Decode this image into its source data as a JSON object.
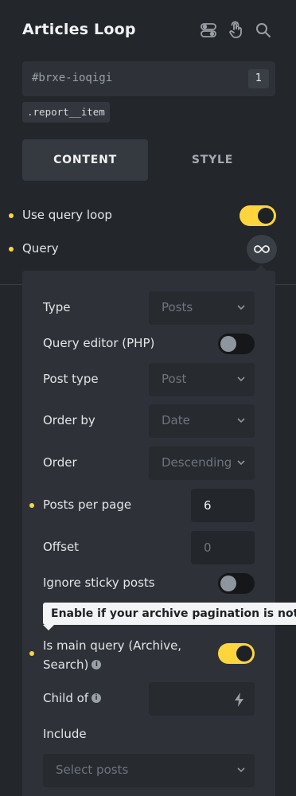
{
  "header": {
    "title": "Articles Loop",
    "icons": [
      "toggle-settings-icon",
      "pointer-hand-icon",
      "search-icon"
    ]
  },
  "element": {
    "id": "#brxe-ioqigi",
    "id_badge": "1",
    "class": ".report__item"
  },
  "tabs": [
    {
      "label": "CONTENT",
      "active": true
    },
    {
      "label": "STYLE",
      "active": false
    }
  ],
  "loop": {
    "use_query_loop_label": "Use query loop",
    "use_query_loop": true,
    "query_label": "Query",
    "query_icon": "infinity-icon"
  },
  "query": {
    "type": {
      "label": "Type",
      "value": "Posts"
    },
    "query_editor": {
      "label": "Query editor (PHP)",
      "value": false
    },
    "post_type": {
      "label": "Post type",
      "value": "Post"
    },
    "order_by": {
      "label": "Order by",
      "value": "Date"
    },
    "order": {
      "label": "Order",
      "value": "Descending"
    },
    "posts_per_page": {
      "label": "Posts per page",
      "value": "6"
    },
    "offset": {
      "label": "Offset",
      "placeholder": "0"
    },
    "ignore_sticky": {
      "label": "Ignore sticky posts",
      "value": false
    },
    "tooltip": "Enable if your archive pagination is not wo",
    "is_main_query": {
      "label_line1": "Is main query (Archive,",
      "label_line2": "Search)",
      "info": "i",
      "value": true
    },
    "child_of": {
      "label": "Child of",
      "info": "i",
      "icon": "bolt-icon"
    },
    "include": {
      "label": "Include",
      "placeholder": "Select posts"
    }
  },
  "colors": {
    "accent": "#ffd53e",
    "background": "#23262b",
    "panel": "#2e3238"
  }
}
